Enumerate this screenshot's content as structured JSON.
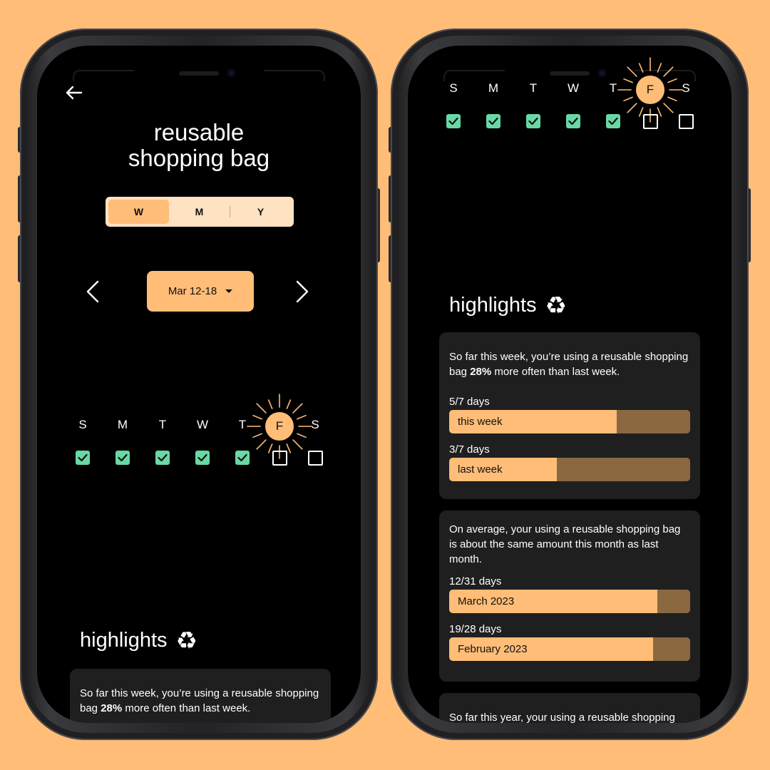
{
  "colors": {
    "background": "#FFBD78",
    "accent": "#FFBD78",
    "check": "#68D8A4",
    "card": "#1F1F1F",
    "bar_track": "#8A6840"
  },
  "left": {
    "title_line1": "reusable",
    "title_line2": "shopping bag",
    "segments": [
      "W",
      "M",
      "Y"
    ],
    "active_segment": "W",
    "date_range": "Mar 12-18",
    "days": [
      "S",
      "M",
      "T",
      "W",
      "T",
      "F",
      "S"
    ],
    "checked": [
      true,
      true,
      true,
      true,
      true,
      false,
      false
    ],
    "highlighted_day": "F",
    "highlights_title": "highlights",
    "card1": {
      "text_before": "So far this week, you’re using a reusable shopping bag ",
      "text_bold": "28%",
      "text_after": " more often than last week."
    }
  },
  "right": {
    "days": [
      "S",
      "M",
      "T",
      "W",
      "T",
      "F",
      "S"
    ],
    "highlighted_day": "F",
    "highlights_title": "highlights",
    "card1": {
      "text_before": "So far this week, you’re using a reusable shopping bag ",
      "text_bold": "28%",
      "text_after": " more often than last week.",
      "bars": [
        {
          "label": "5/7 days",
          "name": "this week",
          "fraction": 0.6939
        },
        {
          "label": "3/7 days",
          "name": "last week",
          "fraction": 0.4478
        }
      ]
    },
    "card2": {
      "text": "On average, your using a reusable shopping bag is about the same amount this month as last month.",
      "bars": [
        {
          "label": "12/31 days",
          "name": "March 2023",
          "fraction": 0.8627
        },
        {
          "label": "19/28 days",
          "name": "February 2023",
          "fraction": 0.8448
        }
      ]
    },
    "card3": {
      "text": "So far this year, your using a reusable shopping"
    }
  }
}
